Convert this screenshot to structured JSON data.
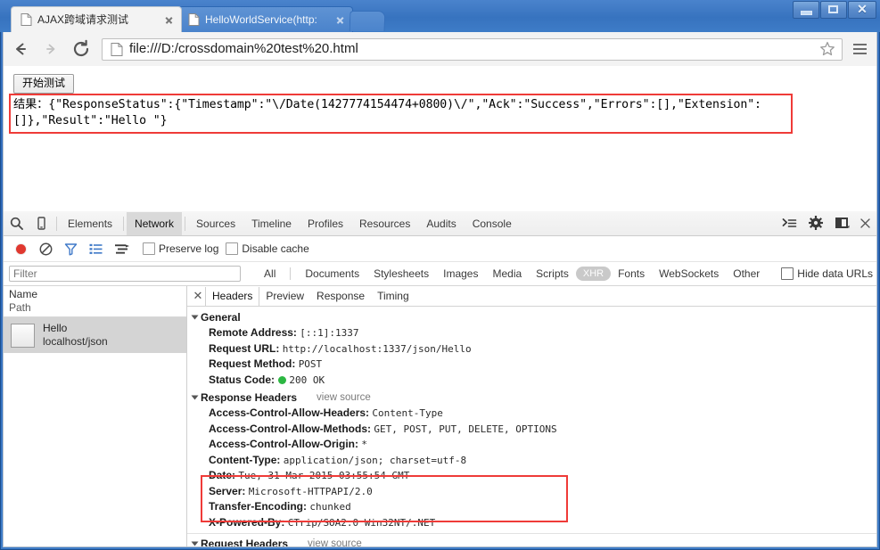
{
  "window": {
    "minimize_label": "—",
    "maximize_label": "□",
    "close_label": "✕"
  },
  "tabs": [
    {
      "title": "AJAX跨域请求测试",
      "active": true
    },
    {
      "title": "HelloWorldService(http:",
      "active": false
    }
  ],
  "toolbar": {
    "back_label": "←",
    "forward_label": "→",
    "reload_label": "⟳",
    "url": "file:///D:/crossdomain%20test%20.html",
    "bookmark_label": "☆",
    "menu_label": "≡"
  },
  "page": {
    "test_button_label": "开始测试",
    "result_text": "结果：{\"ResponseStatus\":{\"Timestamp\":\"\\/Date(1427774154474+0800)\\/\",\"Ack\":\"Success\",\"Errors\":[],\"Extension\":[]},\"Result\":\"Hello \"}",
    "highlight_color": "#ef3b38"
  },
  "devtools": {
    "panels": [
      "Elements",
      "Network",
      "Sources",
      "Timeline",
      "Profiles",
      "Resources",
      "Audits",
      "Console"
    ],
    "active_panel": "Network",
    "inspect_icon": "search-icon",
    "device_icon": "device-toggle-icon",
    "dock_icon": "dock-icon",
    "settings_icon": "gear-icon",
    "more_icon": "drawer-icon",
    "close_icon": "close-icon",
    "controls": {
      "record_label": "record-icon",
      "clear_label": "clear-icon",
      "filter_label": "filter-icon",
      "view_label": "view-icon",
      "waterfall_label": "waterfall-icon",
      "preserve_log": "Preserve log",
      "disable_cache": "Disable cache"
    },
    "filter": {
      "placeholder": "Filter",
      "value": "",
      "types": [
        "All",
        "Documents",
        "Stylesheets",
        "Images",
        "Media",
        "Scripts",
        "XHR",
        "Fonts",
        "WebSockets",
        "Other"
      ],
      "active_type": "XHR",
      "hide_data_urls": "Hide data URLs"
    },
    "requests": {
      "col_name": "Name",
      "col_path": "Path",
      "rows": [
        {
          "name": "Hello",
          "path": "localhost/json"
        }
      ]
    },
    "detail": {
      "close_label": "✕",
      "tabs": [
        "Headers",
        "Preview",
        "Response",
        "Timing"
      ],
      "active_tab": "Headers",
      "sections": [
        {
          "title": "General",
          "view_source": "",
          "rows": [
            {
              "name": "Remote Address:",
              "value": "[::1]:1337"
            },
            {
              "name": "Request URL:",
              "value": "http://localhost:1337/json/Hello"
            },
            {
              "name": "Request Method:",
              "value": "POST"
            },
            {
              "name": "Status Code:",
              "value": "200  OK",
              "status": true
            }
          ]
        },
        {
          "title": "Response Headers",
          "view_source": "view source",
          "rows": [
            {
              "name": "Access-Control-Allow-Headers:",
              "value": "Content-Type"
            },
            {
              "name": "Access-Control-Allow-Methods:",
              "value": "GET, POST, PUT, DELETE, OPTIONS"
            },
            {
              "name": "Access-Control-Allow-Origin:",
              "value": "*"
            },
            {
              "name": "Content-Type:",
              "value": "application/json; charset=utf-8"
            },
            {
              "name": "Date:",
              "value": "Tue, 31 Mar 2015 03:55:54 GMT"
            },
            {
              "name": "Server:",
              "value": "Microsoft-HTTPAPI/2.0"
            },
            {
              "name": "Transfer-Encoding:",
              "value": "chunked"
            },
            {
              "name": "X-Powered-By:",
              "value": "CTrip/SOA2.0 Win32NT/.NET"
            }
          ]
        },
        {
          "title": "Request Headers",
          "view_source": "view source",
          "rows": []
        }
      ]
    }
  }
}
